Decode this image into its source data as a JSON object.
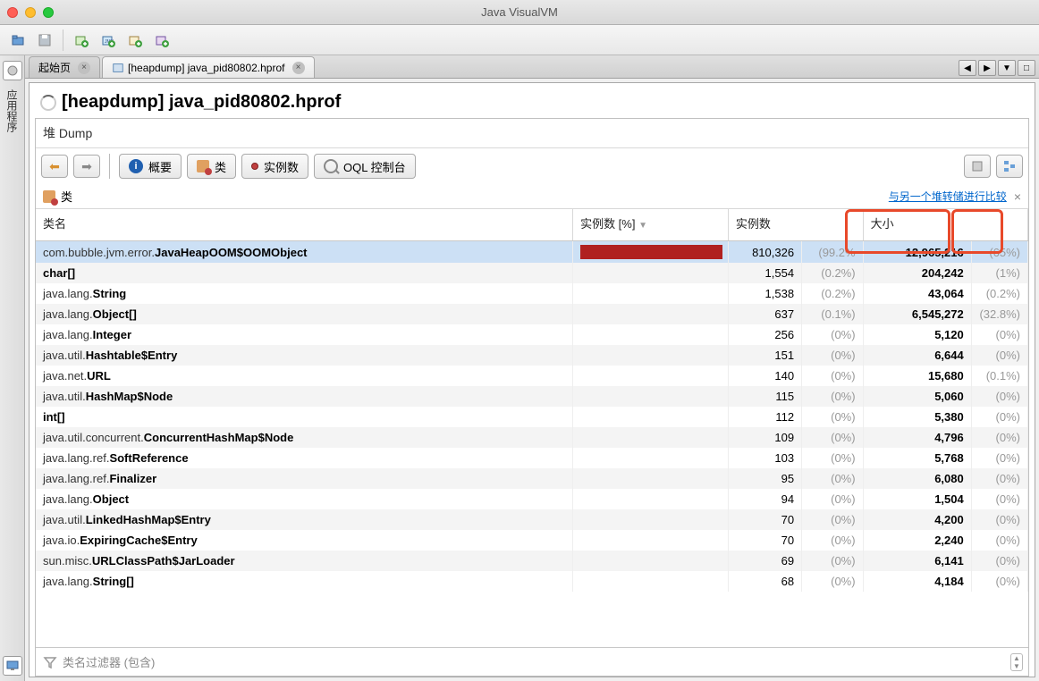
{
  "window_title": "Java VisualVM",
  "sidebar_label": "应用程序",
  "tabs": {
    "tab0": "起始页",
    "tab1": "[heapdump] java_pid80802.hprof"
  },
  "panel_title": "[heapdump] java_pid80802.hprof",
  "sub_title": "堆 Dump",
  "toolbar": {
    "overview": "概要",
    "classes": "类",
    "instances": "实例数",
    "oql": "OQL 控制台"
  },
  "inner_label": "类",
  "compare_link": "与另一个堆转储进行比较",
  "columns": {
    "name": "类名",
    "inst_pct": "实例数 [%]",
    "inst": "实例数",
    "size": "大小"
  },
  "sort_indicator": "▼",
  "filter_placeholder": "类名过滤器 (包含)",
  "rows": [
    {
      "pkg": "com.bubble.jvm.error.",
      "cls": "JavaHeapOOM$OOMObject",
      "barw": 100,
      "inst": "810,326",
      "instp": "(99.2%",
      "size": "12,965,216",
      "sizep": "(65%)"
    },
    {
      "pkg": "",
      "cls": "char[]",
      "barw": 0,
      "inst": "1,554",
      "instp": "(0.2%)",
      "size": "204,242",
      "sizep": "(1%)"
    },
    {
      "pkg": "java.lang.",
      "cls": "String",
      "barw": 0,
      "inst": "1,538",
      "instp": "(0.2%)",
      "size": "43,064",
      "sizep": "(0.2%)"
    },
    {
      "pkg": "java.lang.",
      "cls": "Object[]",
      "barw": 0,
      "inst": "637",
      "instp": "(0.1%)",
      "size": "6,545,272",
      "sizep": "(32.8%)"
    },
    {
      "pkg": "java.lang.",
      "cls": "Integer",
      "barw": 0,
      "inst": "256",
      "instp": "(0%)",
      "size": "5,120",
      "sizep": "(0%)"
    },
    {
      "pkg": "java.util.",
      "cls": "Hashtable$Entry",
      "barw": 0,
      "inst": "151",
      "instp": "(0%)",
      "size": "6,644",
      "sizep": "(0%)"
    },
    {
      "pkg": "java.net.",
      "cls": "URL",
      "barw": 0,
      "inst": "140",
      "instp": "(0%)",
      "size": "15,680",
      "sizep": "(0.1%)"
    },
    {
      "pkg": "java.util.",
      "cls": "HashMap$Node",
      "barw": 0,
      "inst": "115",
      "instp": "(0%)",
      "size": "5,060",
      "sizep": "(0%)"
    },
    {
      "pkg": "",
      "cls": "int[]",
      "barw": 0,
      "inst": "112",
      "instp": "(0%)",
      "size": "5,380",
      "sizep": "(0%)"
    },
    {
      "pkg": "java.util.concurrent.",
      "cls": "ConcurrentHashMap$Node",
      "barw": 0,
      "inst": "109",
      "instp": "(0%)",
      "size": "4,796",
      "sizep": "(0%)"
    },
    {
      "pkg": "java.lang.ref.",
      "cls": "SoftReference",
      "barw": 0,
      "inst": "103",
      "instp": "(0%)",
      "size": "5,768",
      "sizep": "(0%)"
    },
    {
      "pkg": "java.lang.ref.",
      "cls": "Finalizer",
      "barw": 0,
      "inst": "95",
      "instp": "(0%)",
      "size": "6,080",
      "sizep": "(0%)"
    },
    {
      "pkg": "java.lang.",
      "cls": "Object",
      "barw": 0,
      "inst": "94",
      "instp": "(0%)",
      "size": "1,504",
      "sizep": "(0%)"
    },
    {
      "pkg": "java.util.",
      "cls": "LinkedHashMap$Entry",
      "barw": 0,
      "inst": "70",
      "instp": "(0%)",
      "size": "4,200",
      "sizep": "(0%)"
    },
    {
      "pkg": "java.io.",
      "cls": "ExpiringCache$Entry",
      "barw": 0,
      "inst": "70",
      "instp": "(0%)",
      "size": "2,240",
      "sizep": "(0%)"
    },
    {
      "pkg": "sun.misc.",
      "cls": "URLClassPath$JarLoader",
      "barw": 0,
      "inst": "69",
      "instp": "(0%)",
      "size": "6,141",
      "sizep": "(0%)"
    },
    {
      "pkg": "java.lang.",
      "cls": "String[]",
      "barw": 0,
      "inst": "68",
      "instp": "(0%)",
      "size": "4,184",
      "sizep": "(0%)"
    }
  ]
}
